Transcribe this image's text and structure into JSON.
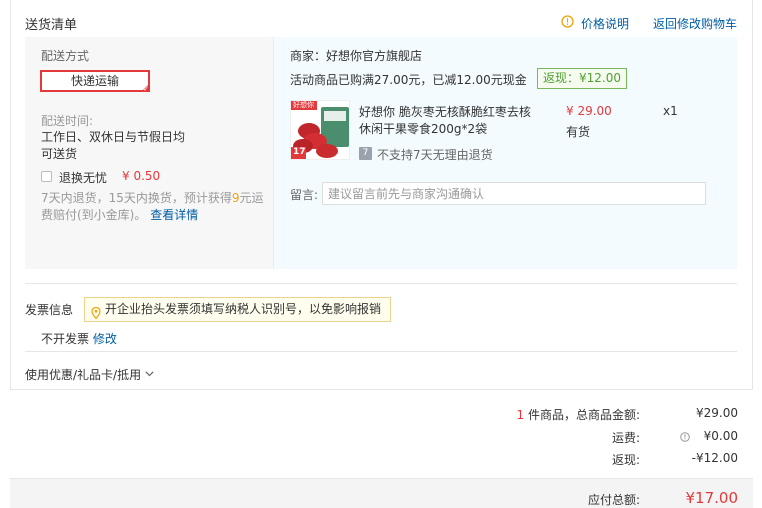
{
  "section": {
    "title": "送货清单",
    "price_info_label": "价格说明",
    "back_to_cart_label": "返回修改购物车"
  },
  "shipping": {
    "method_label": "配送方式",
    "method_value": "快递运输",
    "time_label": "配送时间:",
    "time_line1": "工作日、双休日与节假日均",
    "time_line2": "可送货",
    "worry_free_label": "退换无忧",
    "worry_free_price": "¥ 0.50",
    "policy_line1_a": "7天内退货，15天内换货，预计获得",
    "policy_line1_num": "9",
    "policy_line1_b": "元运",
    "policy_line2": "费赔付(到小金库)。",
    "policy_link": "查看详情"
  },
  "store": {
    "merchant_label": "商家：好想你官方旗舰店",
    "promo_text": "活动商品已购满27.00元，已减12.00元现金",
    "rebate_badge": "返现：¥12.00"
  },
  "product": {
    "name_line1": "好想你 脆灰枣无核酥脆红枣去核",
    "name_line2": "休闲干果零食200g*2袋",
    "price": "¥ 29.00",
    "stock": "有货",
    "quantity": "x1",
    "no_return_icon_text": "7",
    "no_return_text": "不支持7天无理由退货",
    "img_tag": "好想你",
    "img_num": "17"
  },
  "memo": {
    "label": "留言:",
    "placeholder": "建议留言前先与商家沟通确认"
  },
  "invoice": {
    "label": "发票信息",
    "tip": "开企业抬头发票须填写纳税人识别号，以免影响报销",
    "value": "不开发票",
    "modify_link": "修改"
  },
  "coupon": {
    "label": "使用优惠/礼品卡/抵用"
  },
  "summary": {
    "item_count": "1",
    "item_count_suffix": "件商品，总商品金额:",
    "goods_total": "¥29.00",
    "freight_label": "运费:",
    "freight_value": "¥0.00",
    "rebate_label": "返现:",
    "rebate_value": "-¥12.00",
    "payable_label": "应付总额:",
    "payable_value": "¥17.00"
  },
  "colors": {
    "accent_red": "#e4393c",
    "link_blue": "#005ea7",
    "rebate_green": "#52a032",
    "warn_orange": "#f0a30a"
  }
}
